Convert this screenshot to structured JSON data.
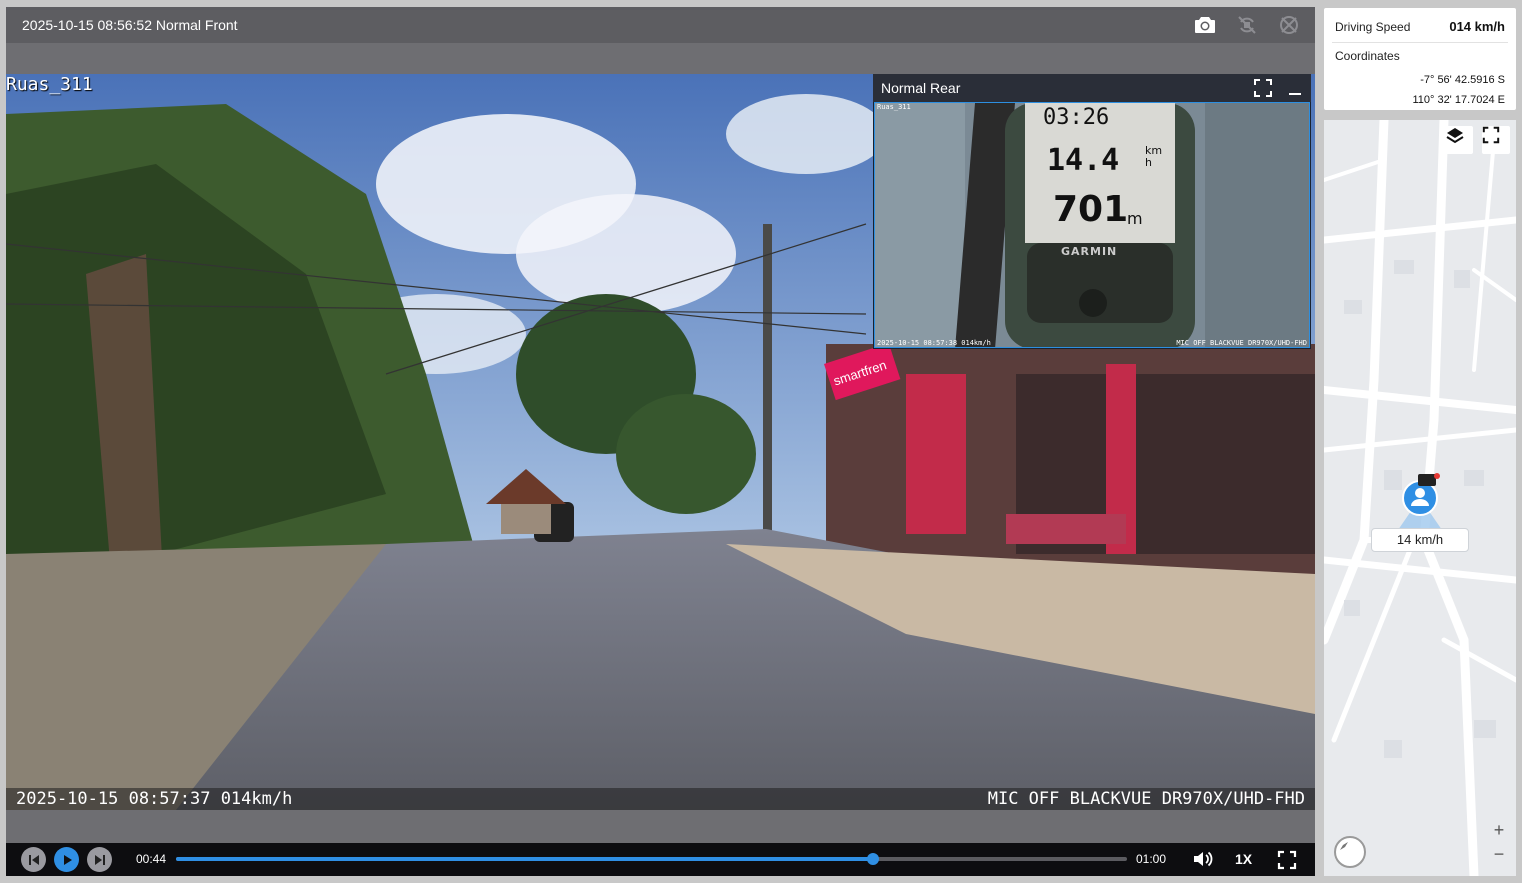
{
  "player": {
    "title": "2025-10-15 08:56:52 Normal Front",
    "icons": [
      "camera-icon",
      "rotate-off-icon",
      "mirror-off-icon"
    ]
  },
  "front_video": {
    "overlay_top": "Ruas_311",
    "overlay_bottom_left": "2025-10-15 08:57:37 014km/h",
    "overlay_bottom_right": "MIC OFF BLACKVUE DR970X/UHD-FHD",
    "sign_text": "smartfren"
  },
  "rear_pip": {
    "title": "Normal Rear",
    "overlay_top": "Ruas_311",
    "overlay_bottom_left": "2025-10-15 08:57:38 014km/h",
    "overlay_bottom_right": "MIC OFF BLACKVUE DR970X/UHD-FHD",
    "gps_time": "03:26",
    "gps_speed": "14.4",
    "gps_speed_unit_top": "km",
    "gps_speed_unit_bottom": "h",
    "gps_distance": "701",
    "gps_distance_unit": "m",
    "gps_brand": "GARMIN"
  },
  "controls": {
    "current_time": "00:44",
    "total_time": "01:00",
    "progress": 0.733,
    "playback_speed": "1X"
  },
  "info": {
    "driving_speed_label": "Driving Speed",
    "driving_speed_value": "014 km/h",
    "coordinates_label": "Coordinates",
    "latitude": "-7° 56' 42.5916 S",
    "longitude": "110° 32' 17.7024 E"
  },
  "map": {
    "speed_chip": "14 km/h",
    "zoom_in": "+",
    "zoom_out": "−",
    "accent": "#2f8fe4"
  }
}
